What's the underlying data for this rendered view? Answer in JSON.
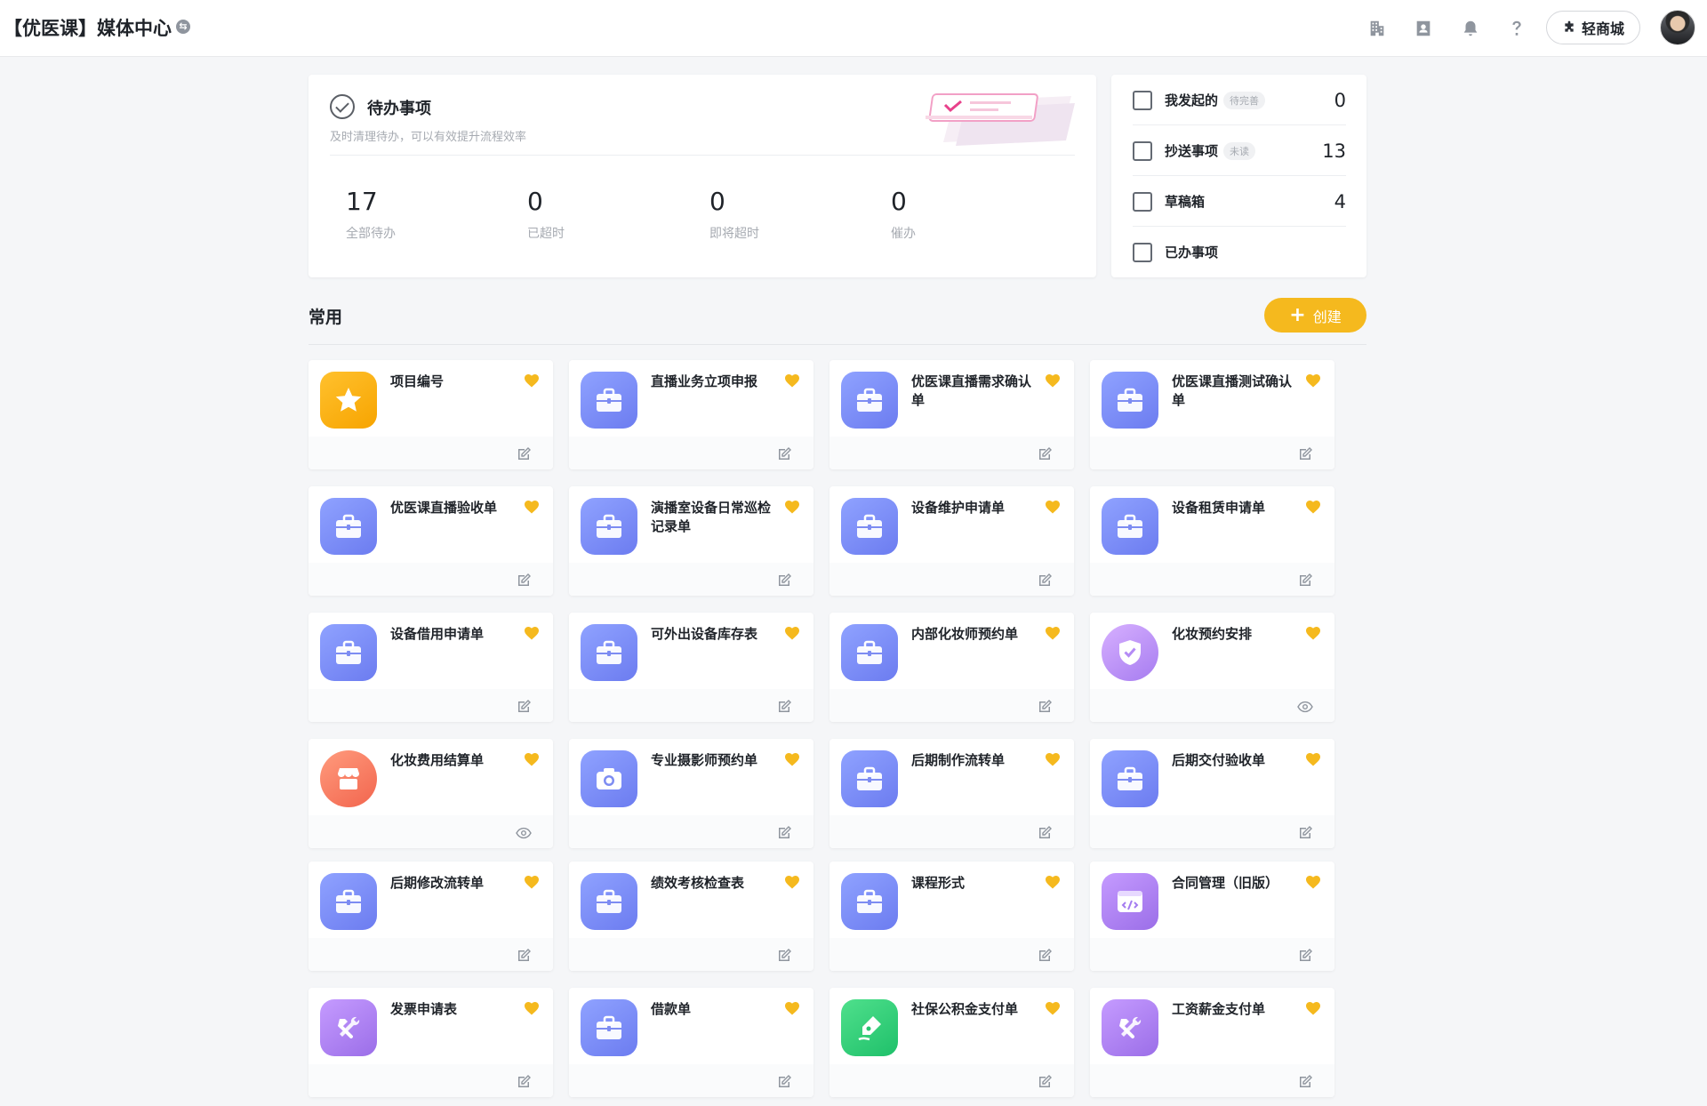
{
  "header": {
    "title": "【优医课】媒体中心",
    "mall_label": "轻商城"
  },
  "todo": {
    "title": "待办事项",
    "subtitle": "及时清理待办，可以有效提升流程效率",
    "stats": [
      {
        "value": "17",
        "label": "全部待办"
      },
      {
        "value": "0",
        "label": "已超时"
      },
      {
        "value": "0",
        "label": "即将超时"
      },
      {
        "value": "0",
        "label": "催办"
      }
    ]
  },
  "side": [
    {
      "label": "我发起的",
      "badge": "待完善",
      "count": "0"
    },
    {
      "label": "抄送事项",
      "badge": "未读",
      "count": "13"
    },
    {
      "label": "草稿箱",
      "badge": "",
      "count": "4"
    },
    {
      "label": "已办事项",
      "badge": "",
      "count": ""
    }
  ],
  "common": {
    "title": "常用",
    "create_label": "创建"
  },
  "apps": [
    {
      "name": "项目编号",
      "icon": "star-icon",
      "action": "edit-icon"
    },
    {
      "name": "直播业务立项申报",
      "icon": "briefcase-icon",
      "action": "edit-icon"
    },
    {
      "name": "优医课直播需求确认单",
      "icon": "briefcase-icon",
      "action": "edit-icon"
    },
    {
      "name": "优医课直播测试确认单",
      "icon": "briefcase-icon",
      "action": "edit-icon"
    },
    {
      "name": "优医课直播验收单",
      "icon": "briefcase-icon",
      "action": "edit-icon"
    },
    {
      "name": "演播室设备日常巡检记录单",
      "icon": "briefcase-icon",
      "action": "edit-icon"
    },
    {
      "name": "设备维护申请单",
      "icon": "briefcase-icon",
      "action": "edit-icon"
    },
    {
      "name": "设备租赁申请单",
      "icon": "briefcase-icon",
      "action": "edit-icon"
    },
    {
      "name": "设备借用申请单",
      "icon": "briefcase-icon",
      "action": "edit-icon"
    },
    {
      "name": "可外出设备库存表",
      "icon": "briefcase-icon",
      "action": "edit-icon"
    },
    {
      "name": "内部化妆师预约单",
      "icon": "briefcase-icon",
      "action": "edit-icon"
    },
    {
      "name": "化妆预约安排",
      "icon": "shield-icon",
      "action": "eye-icon"
    },
    {
      "name": "化妆费用结算单",
      "icon": "shop-icon",
      "action": "eye-icon"
    },
    {
      "name": "专业摄影师预约单",
      "icon": "camera-icon",
      "action": "edit-icon"
    },
    {
      "name": "后期制作流转单",
      "icon": "briefcase-icon",
      "action": "edit-icon"
    },
    {
      "name": "后期交付验收单",
      "icon": "briefcase-icon",
      "action": "edit-icon"
    },
    {
      "name": "后期修改流转单",
      "icon": "briefcase-icon",
      "action": "edit-icon"
    },
    {
      "name": "绩效考核检查表",
      "icon": "briefcase-icon",
      "action": "edit-icon"
    },
    {
      "name": "课程形式",
      "icon": "briefcase-icon",
      "action": "edit-icon"
    },
    {
      "name": "合同管理（旧版）",
      "icon": "code-window-icon",
      "action": "edit-icon"
    },
    {
      "name": "发票申请表",
      "icon": "tools-icon",
      "action": "edit-icon"
    },
    {
      "name": "借款单",
      "icon": "briefcase-icon",
      "action": "edit-icon"
    },
    {
      "name": "社保公积金支付单",
      "icon": "pen-icon",
      "action": "edit-icon"
    },
    {
      "name": "工资薪金支付单",
      "icon": "tools-icon",
      "action": "edit-icon"
    }
  ],
  "colors": {
    "accent": "#f5b91e",
    "briefcase": "#6c7cf0",
    "favorite": "#f5b91e"
  }
}
